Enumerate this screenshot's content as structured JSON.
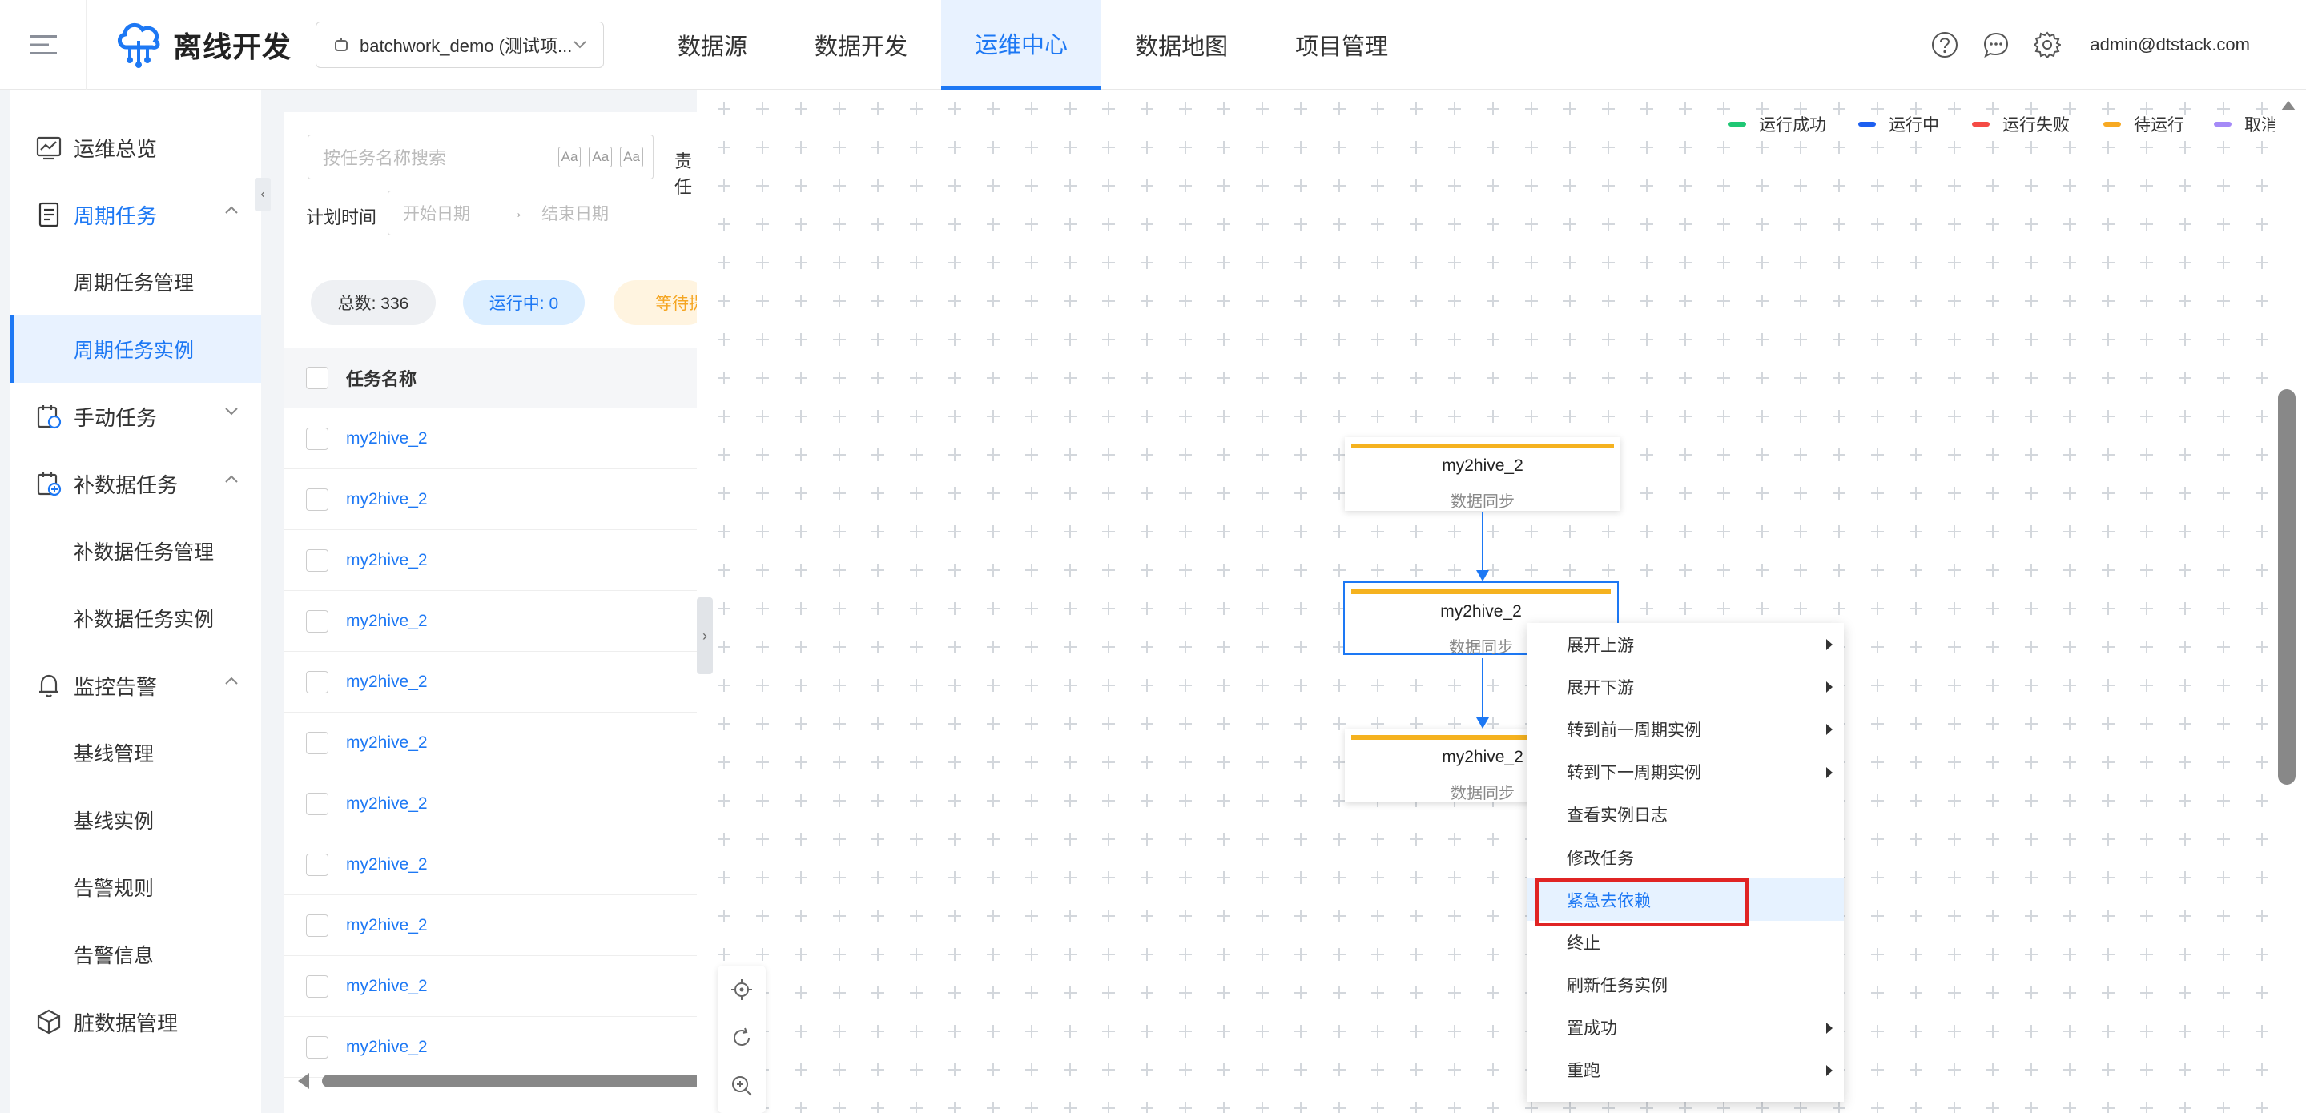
{
  "header": {
    "app_title": "离线开发",
    "project": "batchwork_demo (测试项...",
    "nav": [
      {
        "label": "数据源",
        "active": false
      },
      {
        "label": "数据开发",
        "active": false
      },
      {
        "label": "运维中心",
        "active": true
      },
      {
        "label": "数据地图",
        "active": false
      },
      {
        "label": "项目管理",
        "active": false
      }
    ],
    "user": "admin@dtstack.com"
  },
  "sidebar": {
    "collapse_glyph": "‹",
    "items": [
      {
        "type": "group",
        "label": "运维总览",
        "icon": "dashboard-icon"
      },
      {
        "type": "group",
        "label": "周期任务",
        "icon": "document-icon",
        "expanded": true,
        "active": true
      },
      {
        "type": "sub",
        "label": "周期任务管理"
      },
      {
        "type": "sub",
        "label": "周期任务实例",
        "active": true
      },
      {
        "type": "group",
        "label": "手动任务",
        "icon": "manual-task-icon",
        "expanded": false
      },
      {
        "type": "group",
        "label": "补数据任务",
        "icon": "calendar-add-icon",
        "expanded": true
      },
      {
        "type": "sub",
        "label": "补数据任务管理"
      },
      {
        "type": "sub",
        "label": "补数据任务实例"
      },
      {
        "type": "group",
        "label": "监控告警",
        "icon": "bell-icon",
        "expanded": true
      },
      {
        "type": "sub",
        "label": "基线管理"
      },
      {
        "type": "sub",
        "label": "基线实例"
      },
      {
        "type": "sub",
        "label": "告警规则"
      },
      {
        "type": "sub",
        "label": "告警信息"
      },
      {
        "type": "group",
        "label": "脏数据管理",
        "icon": "cube-icon"
      }
    ]
  },
  "filters": {
    "search_placeholder": "按任务名称搜索",
    "toggle_case": "Aa",
    "toggle_word": "Aa",
    "toggle_regex": "Aa",
    "owner_label": "责任",
    "plan_time_label": "计划时间",
    "start_placeholder": "开始日期",
    "end_placeholder": "结束日期",
    "range_arrow": "→"
  },
  "stats": {
    "total": "总数: 336",
    "running": "运行中: 0",
    "waiting": "等待提"
  },
  "table": {
    "column": "任务名称",
    "rows": [
      "my2hive_2",
      "my2hive_2",
      "my2hive_2",
      "my2hive_2",
      "my2hive_2",
      "my2hive_2",
      "my2hive_2",
      "my2hive_2",
      "my2hive_2",
      "my2hive_2",
      "my2hive_2"
    ]
  },
  "legend": [
    {
      "label": "运行成功",
      "color": "#1fc774"
    },
    {
      "label": "运行中",
      "color": "#1d5ff0"
    },
    {
      "label": "运行失败",
      "color": "#f54b45"
    },
    {
      "label": "待运行",
      "color": "#f7a922"
    },
    {
      "label": "取消",
      "color": "#a58af7"
    }
  ],
  "graph": {
    "expand_glyph": "›",
    "nodes": [
      {
        "name": "my2hive_2",
        "type": "数据同步"
      },
      {
        "name": "my2hive_2",
        "type": "数据同步",
        "selected": true
      },
      {
        "name": "my2hive_2",
        "type": "数据同步"
      }
    ],
    "node_status_color": "#f5b21f"
  },
  "context_menu": [
    {
      "label": "展开上游",
      "submenu": true
    },
    {
      "label": "展开下游",
      "submenu": true
    },
    {
      "label": "转到前一周期实例",
      "submenu": true
    },
    {
      "label": "转到下一周期实例",
      "submenu": true
    },
    {
      "label": "查看实例日志",
      "submenu": false
    },
    {
      "label": "修改任务",
      "submenu": false
    },
    {
      "label": "紧急去依赖",
      "submenu": false,
      "highlighted": true
    },
    {
      "label": "终止",
      "submenu": false
    },
    {
      "label": "刷新任务实例",
      "submenu": false
    },
    {
      "label": "置成功",
      "submenu": true
    },
    {
      "label": "重跑",
      "submenu": true
    }
  ],
  "colors": {
    "accent": "#1d78f4",
    "highlight_box": "#e02424"
  }
}
